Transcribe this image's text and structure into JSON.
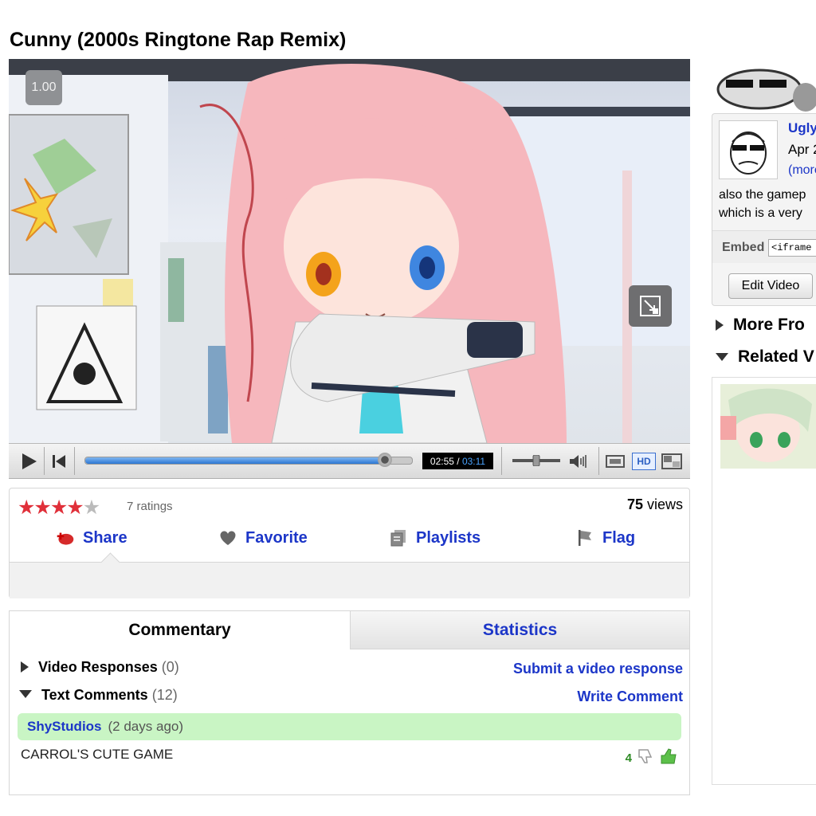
{
  "page": {
    "title": "Cunny (2000s Ringtone Rap Remix)"
  },
  "player": {
    "speed": "1.00",
    "current_time": "02:55",
    "time_separator": "/",
    "total_time": "03:11",
    "progress": 0.917,
    "volume": 0.5,
    "hd_label": "HD"
  },
  "rating": {
    "stars": 4,
    "max_stars": 5,
    "count_text": "7 ratings",
    "views_count": "75",
    "views_label": "views"
  },
  "actions": {
    "share": "Share",
    "favorite": "Favorite",
    "playlists": "Playlists",
    "flag": "Flag"
  },
  "tabs": {
    "commentary": "Commentary",
    "statistics": "Statistics"
  },
  "responses": {
    "video_responses_label": "Video Responses",
    "video_responses_count": "(0)",
    "submit_link": "Submit a video response",
    "text_comments_label": "Text Comments",
    "text_comments_count": "(12)",
    "write_link": "Write Comment"
  },
  "comments": [
    {
      "author": "ShyStudios",
      "when": "(2 days ago)",
      "text": "CARROL'S CUTE GAME",
      "score": "4"
    }
  ],
  "sidebar": {
    "uploader_name": "Ugly",
    "upload_date": "Apr 2",
    "more_open": "(",
    "more_link": "more",
    "description_line1": "also the gamep",
    "description_line2": "which is a very",
    "embed_label": "Embed",
    "embed_value": "<iframe al",
    "edit_button": "Edit Video",
    "more_from": "More Fro",
    "related": "Related V"
  },
  "colors": {
    "link_blue": "#1c36c8",
    "star_red": "#e0303a",
    "comment_green": "#c9f5c4",
    "progress_blue": "#2b76d3"
  }
}
